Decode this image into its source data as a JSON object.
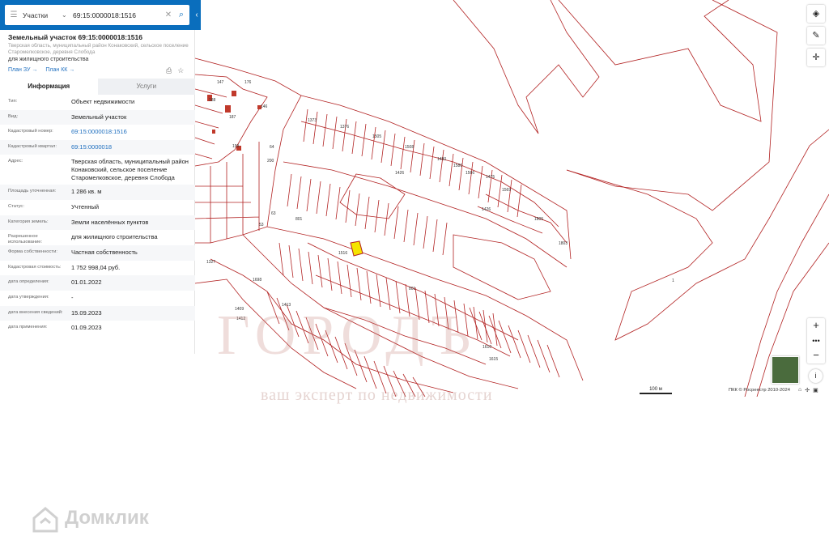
{
  "search": {
    "type_label": "Участки",
    "query": "69:15:0000018:1516"
  },
  "object": {
    "title": "Земельный участок 69:15:0000018:1516",
    "address_short": "Тверская область, муниципальный район Конаковский, сельское поселение Старомелковское, деревня Слобода",
    "use": "для жилищного строительства",
    "link_plan_zu": "План ЗУ →",
    "link_plan_kk": "План КК →"
  },
  "tabs": [
    {
      "label": "Информация",
      "active": true
    },
    {
      "label": "Услуги",
      "active": false
    }
  ],
  "info_rows": [
    {
      "key": "Тип:",
      "value": "Объект недвижимости",
      "link": false
    },
    {
      "key": "Вид:",
      "value": "Земельный участок",
      "link": false
    },
    {
      "key": "Кадастровый номер:",
      "value": "69:15:0000018:1516",
      "link": true
    },
    {
      "key": "Кадастровый квартал:",
      "value": "69:15:0000018",
      "link": true
    },
    {
      "key": "Адрес:",
      "value": "Тверская область, муниципальный район Конаковский, сельское поселение Старомелковское, деревня Слобода",
      "link": false
    },
    {
      "key": "Площадь уточненная:",
      "value": "1 286 кв. м",
      "link": false
    },
    {
      "key": "Статус:",
      "value": "Учтенный",
      "link": false
    },
    {
      "key": "Категория земель:",
      "value": "Земли населённых пунктов",
      "link": false
    },
    {
      "key": "Разрешенное использование:",
      "value": "для жилищного строительства",
      "link": false
    },
    {
      "key": "Форма собственности:",
      "value": "Частная собственность",
      "link": false
    },
    {
      "key": "Кадастровая стоимость:",
      "value": "1 752 998,04 руб.",
      "link": false
    },
    {
      "key": "дата определения:",
      "value": "01.01.2022",
      "link": false
    },
    {
      "key": "дата утверждения:",
      "value": "-",
      "link": false
    },
    {
      "key": "дата внесения сведений:",
      "value": "15.09.2023",
      "link": false
    },
    {
      "key": "дата применения:",
      "value": "01.09.2023",
      "link": false
    }
  ],
  "map": {
    "scale_label": "100 м",
    "attribution": "ПКК © Росреестр 2010-2024",
    "parcel_labels": [
      "147",
      "176",
      "146",
      "188",
      "187",
      "199",
      "200",
      "63",
      "64",
      "53",
      "801",
      "1426",
      "1803",
      "1805",
      "1327",
      "1698",
      "1409",
      "1412",
      "1413",
      "1516",
      "1426",
      "1",
      "801",
      "1580",
      "1373",
      "1376",
      "1505",
      "1508",
      "1480",
      "1475",
      "1566",
      "1569",
      "1610",
      "1615"
    ],
    "watermark_main": "ГОРОДЪ",
    "watermark_tagline": "ваш эксперт по недвижимости",
    "line_color": "#b22222",
    "selected_color": "#f5e400"
  },
  "footer": {
    "brand": "Домклик"
  }
}
